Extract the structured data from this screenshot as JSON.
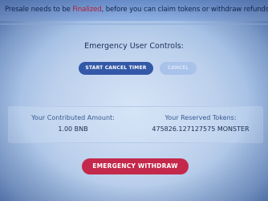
{
  "notice": {
    "prefix": "Presale needs to be ",
    "highlight": "Finalized",
    "suffix": ", before you can claim tokens or withdraw refunds!"
  },
  "controls": {
    "title": "Emergency User Controls:",
    "start_cancel_timer_label": "START CANCEL TIMER",
    "disabled_button_label": "CANCEL"
  },
  "stats": {
    "contributed_label": "Your Contributed Amount:",
    "contributed_value": "1.00 BNB",
    "reserved_label": "Your Reserved Tokens:",
    "reserved_value": "475826.127127575 MONSTER"
  },
  "withdraw": {
    "label": "EMERGENCY WITHDRAW"
  },
  "colors": {
    "primary_button": "#3358a8",
    "danger_button": "#c4284b",
    "highlight_text": "#c2182b"
  }
}
